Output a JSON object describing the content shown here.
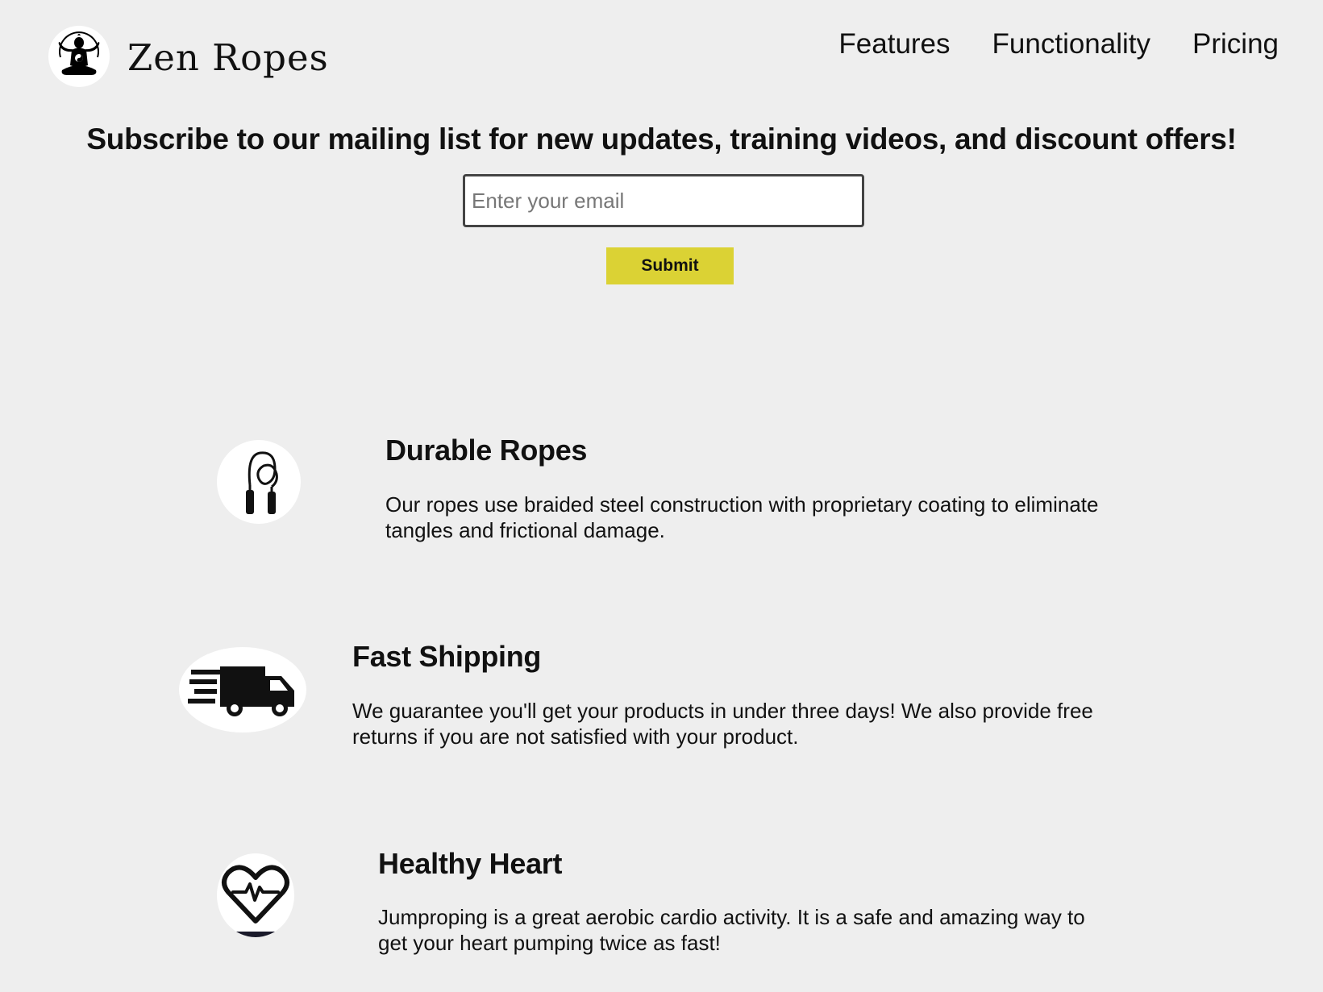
{
  "header": {
    "brand": "Zen Ropes",
    "logo_icon": "meditating-figure-icon",
    "nav": [
      "Features",
      "Functionality",
      "Pricing"
    ]
  },
  "subscribe": {
    "heading": "Subscribe to our mailing list for new updates, training videos, and discount offers!",
    "email_placeholder": "Enter your email",
    "email_value": "",
    "submit_label": "Submit"
  },
  "features": [
    {
      "icon": "jump-rope-icon",
      "title": "Durable Ropes",
      "description": "Our ropes use braided steel construction with proprietary coating to eliminate tangles and frictional damage."
    },
    {
      "icon": "delivery-truck-icon",
      "title": "Fast Shipping",
      "description": "We guarantee you'll get your products in under three days! We also provide free returns if you are not satisfied with your product."
    },
    {
      "icon": "heart-pulse-icon",
      "title": "Healthy Heart",
      "description": "Jumproping is a great aerobic cardio activity. It is a safe and amazing way to get your heart pumping twice as fast!"
    }
  ],
  "colors": {
    "background": "#eeeeee",
    "submit_button": "#dbd234"
  }
}
